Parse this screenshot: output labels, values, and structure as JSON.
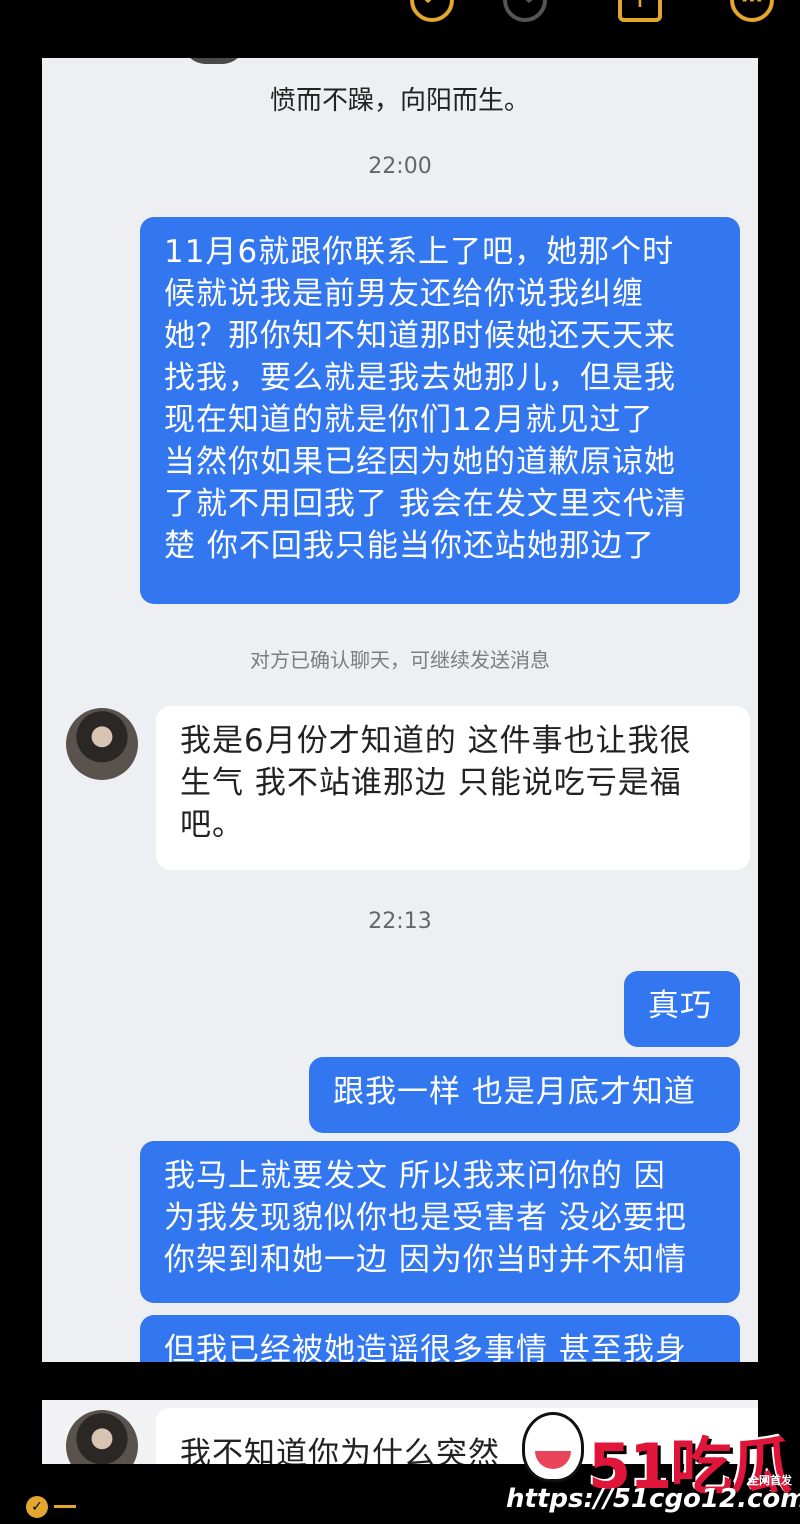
{
  "header": {
    "icons": [
      "undo-icon",
      "redo-icon",
      "share-icon",
      "more-icon"
    ]
  },
  "chat": {
    "caption": "愤而不躁，向阳而生。",
    "time_1": "22:00",
    "message_1": "11月6就跟你联系上了吧，她那个时\n候就说我是前男友还给你说我纠缠\n她？那你知不知道那时候她还天天来\n找我，要么就是我去她那儿，但是我\n现在知道的就是你们12月就见过了\n当然你如果已经因为她的道歉原谅她\n了就不用回我了 我会在发文里交代清\n楚 你不回我只能当你还站她那边了",
    "system_notice": "对方已确认聊天，可继续发送消息",
    "reply_1": "我是6月份才知道的 这件事也让我很\n生气 我不站谁那边 只能说吃亏是福\n吧。",
    "time_2": "22:13",
    "message_2": "真巧",
    "message_3": "跟我一样 也是月底才知道",
    "message_4": "我马上就要发文 所以我来问你的 因\n为我发现貌似你也是受害者 没必要把\n你架到和她一边 因为你当时并不知情",
    "message_5_partial": "但我已经被她造谣很多事情 甚至我身"
  },
  "bottom": {
    "partial_text": "我不知道你为什么突然"
  },
  "watermark": {
    "logo": "51吃瓜",
    "badge": "全网首发",
    "url": "https://51cgo12.com"
  },
  "colors": {
    "outgoing_bubble": "#3377f0",
    "incoming_bubble": "#ffffff",
    "chat_background": "#eeeff3",
    "accent": "#e3a72f"
  }
}
